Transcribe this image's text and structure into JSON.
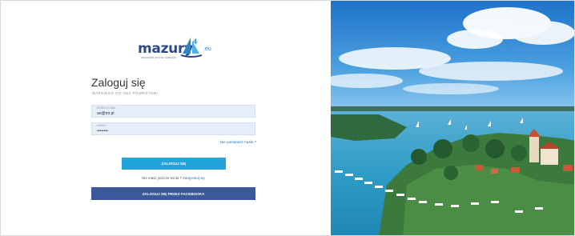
{
  "logo": {
    "wordmark": "mazury",
    "domain": ".eu",
    "tagline": "mazurskie jeziora i wakacje"
  },
  "login": {
    "heading": "Zaloguj się",
    "subheading": "WAZNIEGO DO GĘZ POWRÓTEM!",
    "email": {
      "label": "ADRES E-MAIL",
      "value": "ao@mr.pl"
    },
    "password": {
      "label": "HASŁO",
      "value": "••••••••"
    },
    "forgot_link": "Nie pamiętasz hasła ?",
    "login_button": "ZALOGUJ SIĘ",
    "register_prompt": "Nie masz jeszcze konta ?",
    "register_link": "Zarejestruj się",
    "facebook_button": "ZALOGUJ SIĘ PRZEZ FACEBOOKA"
  },
  "photo": {
    "subject": "mazury-lake-aerial-photo"
  },
  "colors": {
    "brand_blue": "#2b4a8c",
    "login_button": "#22a3dc",
    "facebook_button": "#3b5998",
    "field_background": "#e6eef9",
    "link": "#2f75c0"
  }
}
